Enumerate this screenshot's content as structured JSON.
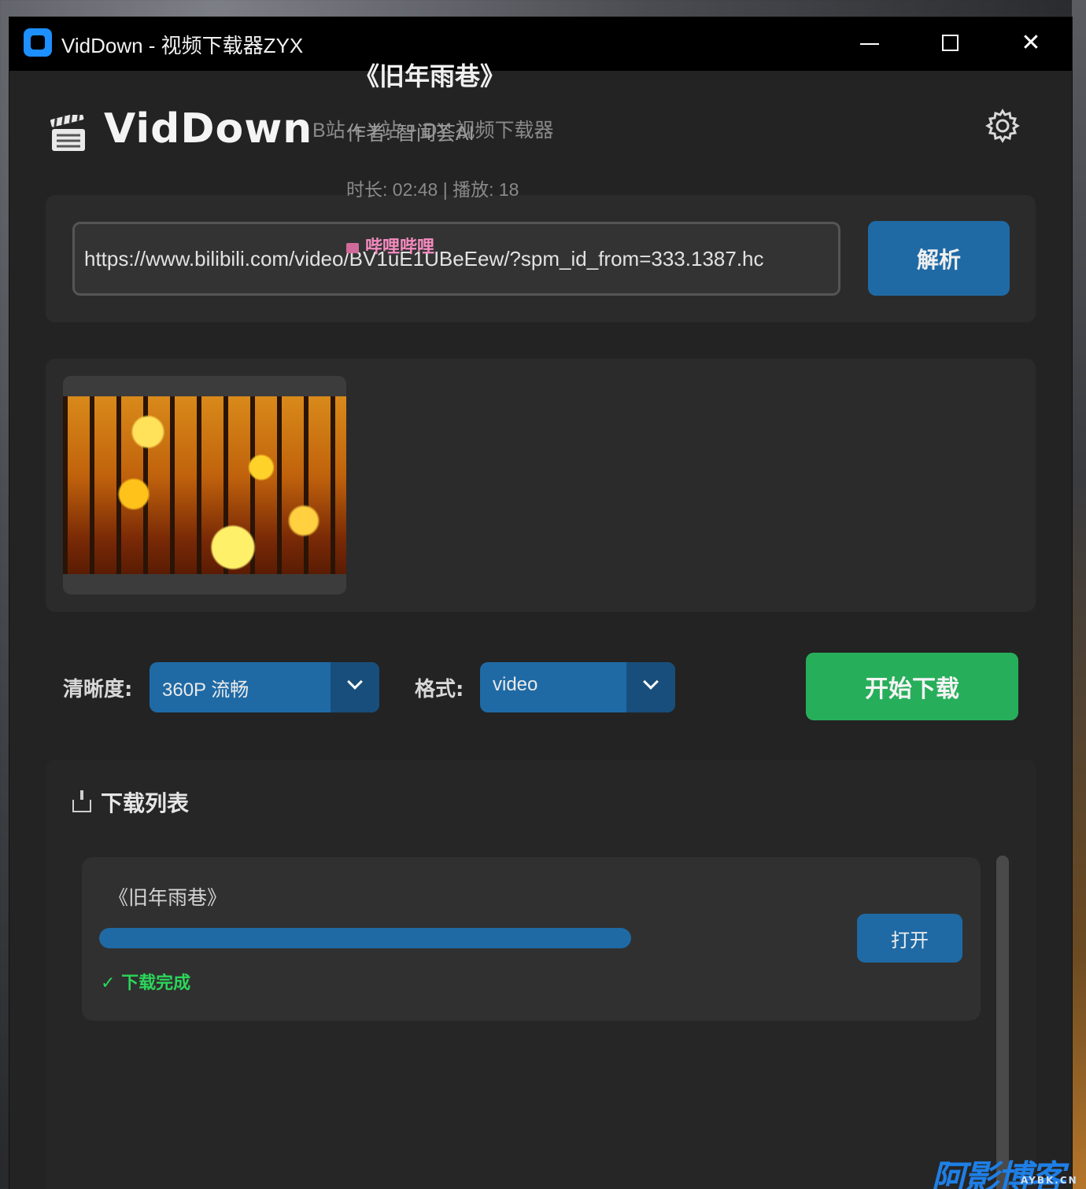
{
  "window": {
    "title": "VidDown - 视频下载器ZYX",
    "minimize_glyph": "",
    "close_glyph": "✕"
  },
  "header": {
    "brand": "VidDown",
    "tagline": "B站 + Y站 + DY 视频下载器",
    "settings_icon": "gear-icon",
    "logo_icon": "clapperboard-icon"
  },
  "url_bar": {
    "value": "https://www.bilibili.com/video/BV1uE1UBeEew/?spm_id_from=333.1387.hc",
    "parse_label": "解析"
  },
  "video": {
    "title": "《旧年雨巷》",
    "author": "作者: 智闻荟AI",
    "meta": "时长: 02:48 | 播放: 18",
    "source": "哔哩哔哩"
  },
  "options": {
    "quality_label": "清晰度:",
    "quality_value": "360P 流畅",
    "format_label": "格式:",
    "format_value": "video",
    "download_label": "开始下载"
  },
  "download_list": {
    "heading": "下载列表",
    "items": [
      {
        "title": "《旧年雨巷》",
        "progress": 1.0,
        "status": "✓ 下载完成",
        "open_label": "打开"
      }
    ]
  },
  "colors": {
    "accent_blue": "#1f6aa5",
    "download_green": "#27ae5a",
    "status_green": "#2bd65a",
    "source_pink": "#f58bc0"
  },
  "watermark": {
    "main": "阿影博客",
    "sub": "AYBK.CN"
  }
}
